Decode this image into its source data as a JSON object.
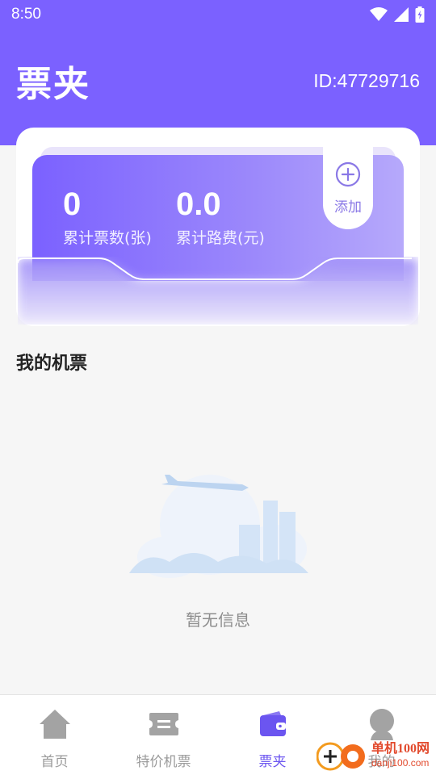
{
  "status_bar": {
    "time": "8:50"
  },
  "header": {
    "title": "票夹",
    "user_id": "ID:47729716"
  },
  "stats": {
    "tickets_value": "0",
    "tickets_label": "累计票数(张)",
    "fare_value": "0.0",
    "fare_label": "累计路费(元)",
    "add_label": "添加"
  },
  "section": {
    "title": "我的机票"
  },
  "empty_state": {
    "text": "暂无信息"
  },
  "tabbar": {
    "items": [
      {
        "label": "首页",
        "icon": "home-icon"
      },
      {
        "label": "特价机票",
        "icon": "ticket-icon"
      },
      {
        "label": "票夹",
        "icon": "wallet-icon",
        "active": true
      },
      {
        "label": "我的",
        "icon": "profile-icon"
      }
    ]
  },
  "watermark": {
    "brand": "单机100网",
    "url": "danji100.com"
  },
  "colors": {
    "accent": "#7b61ff",
    "accent_light": "#b6a9fb",
    "active_tab": "#6b55f0",
    "background": "#f6f6f6"
  }
}
